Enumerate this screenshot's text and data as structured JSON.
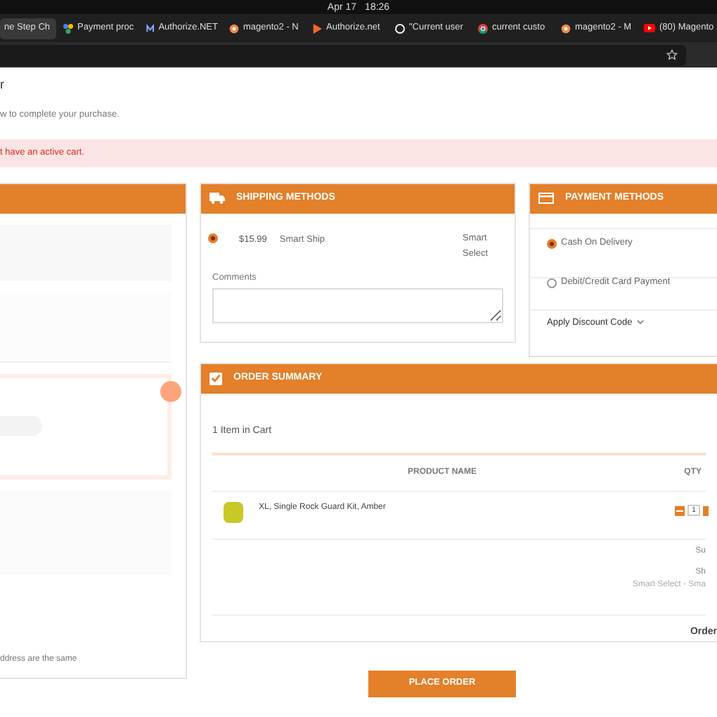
{
  "system_bar": {
    "date": "Apr 17",
    "time": "18:26"
  },
  "browser_tabs": [
    {
      "title": "ne Step Ch",
      "selected": true,
      "kind": "none"
    },
    {
      "title": "Payment proc",
      "selected": false,
      "kind": "dots"
    },
    {
      "title": "Authorize.NET",
      "selected": false,
      "kind": "letter"
    },
    {
      "title": "magento2 - N",
      "selected": false,
      "kind": "magento"
    },
    {
      "title": "Authorize.net",
      "selected": false,
      "kind": "play"
    },
    {
      "title": "\"Current user",
      "selected": false,
      "kind": "github"
    },
    {
      "title": "current custo",
      "selected": false,
      "kind": "chrome"
    },
    {
      "title": "magento2 - M",
      "selected": false,
      "kind": "magento"
    },
    {
      "title": "(80) Magento",
      "selected": false,
      "kind": "youtube"
    }
  ],
  "page": {
    "heading": "r",
    "intro": "w to complete your purchase.",
    "alert": "t have an active cart."
  },
  "left_panel": {
    "note": "ddress are the same"
  },
  "shipping": {
    "title": "SHIPPING METHODS",
    "methods": [
      {
        "price": "$15.99",
        "carrier": "Smart Ship",
        "method": "Smart Select",
        "selected": true
      }
    ],
    "comments_label": "Comments"
  },
  "payment": {
    "title": "PAYMENT METHODS",
    "options": [
      {
        "label": "Cash On Delivery",
        "selected": true
      },
      {
        "label": "Debit/Credit Card Payment",
        "selected": false
      }
    ],
    "discount_link": "Apply Discount Code"
  },
  "order_summary": {
    "title": "ORDER SUMMARY",
    "checked": true,
    "count": "1 Item in Cart",
    "columns": [
      "PRODUCT NAME",
      "QTY"
    ],
    "items": [
      {
        "name": "XL, Single Rock Guard Kit, Amber",
        "qty": "1"
      }
    ],
    "totals": [
      {
        "label": "Su"
      },
      {
        "label": "Sh",
        "detail": "Smart Select - Sma"
      }
    ],
    "grand_total": "Order"
  },
  "place_order": "PLACE ORDER"
}
